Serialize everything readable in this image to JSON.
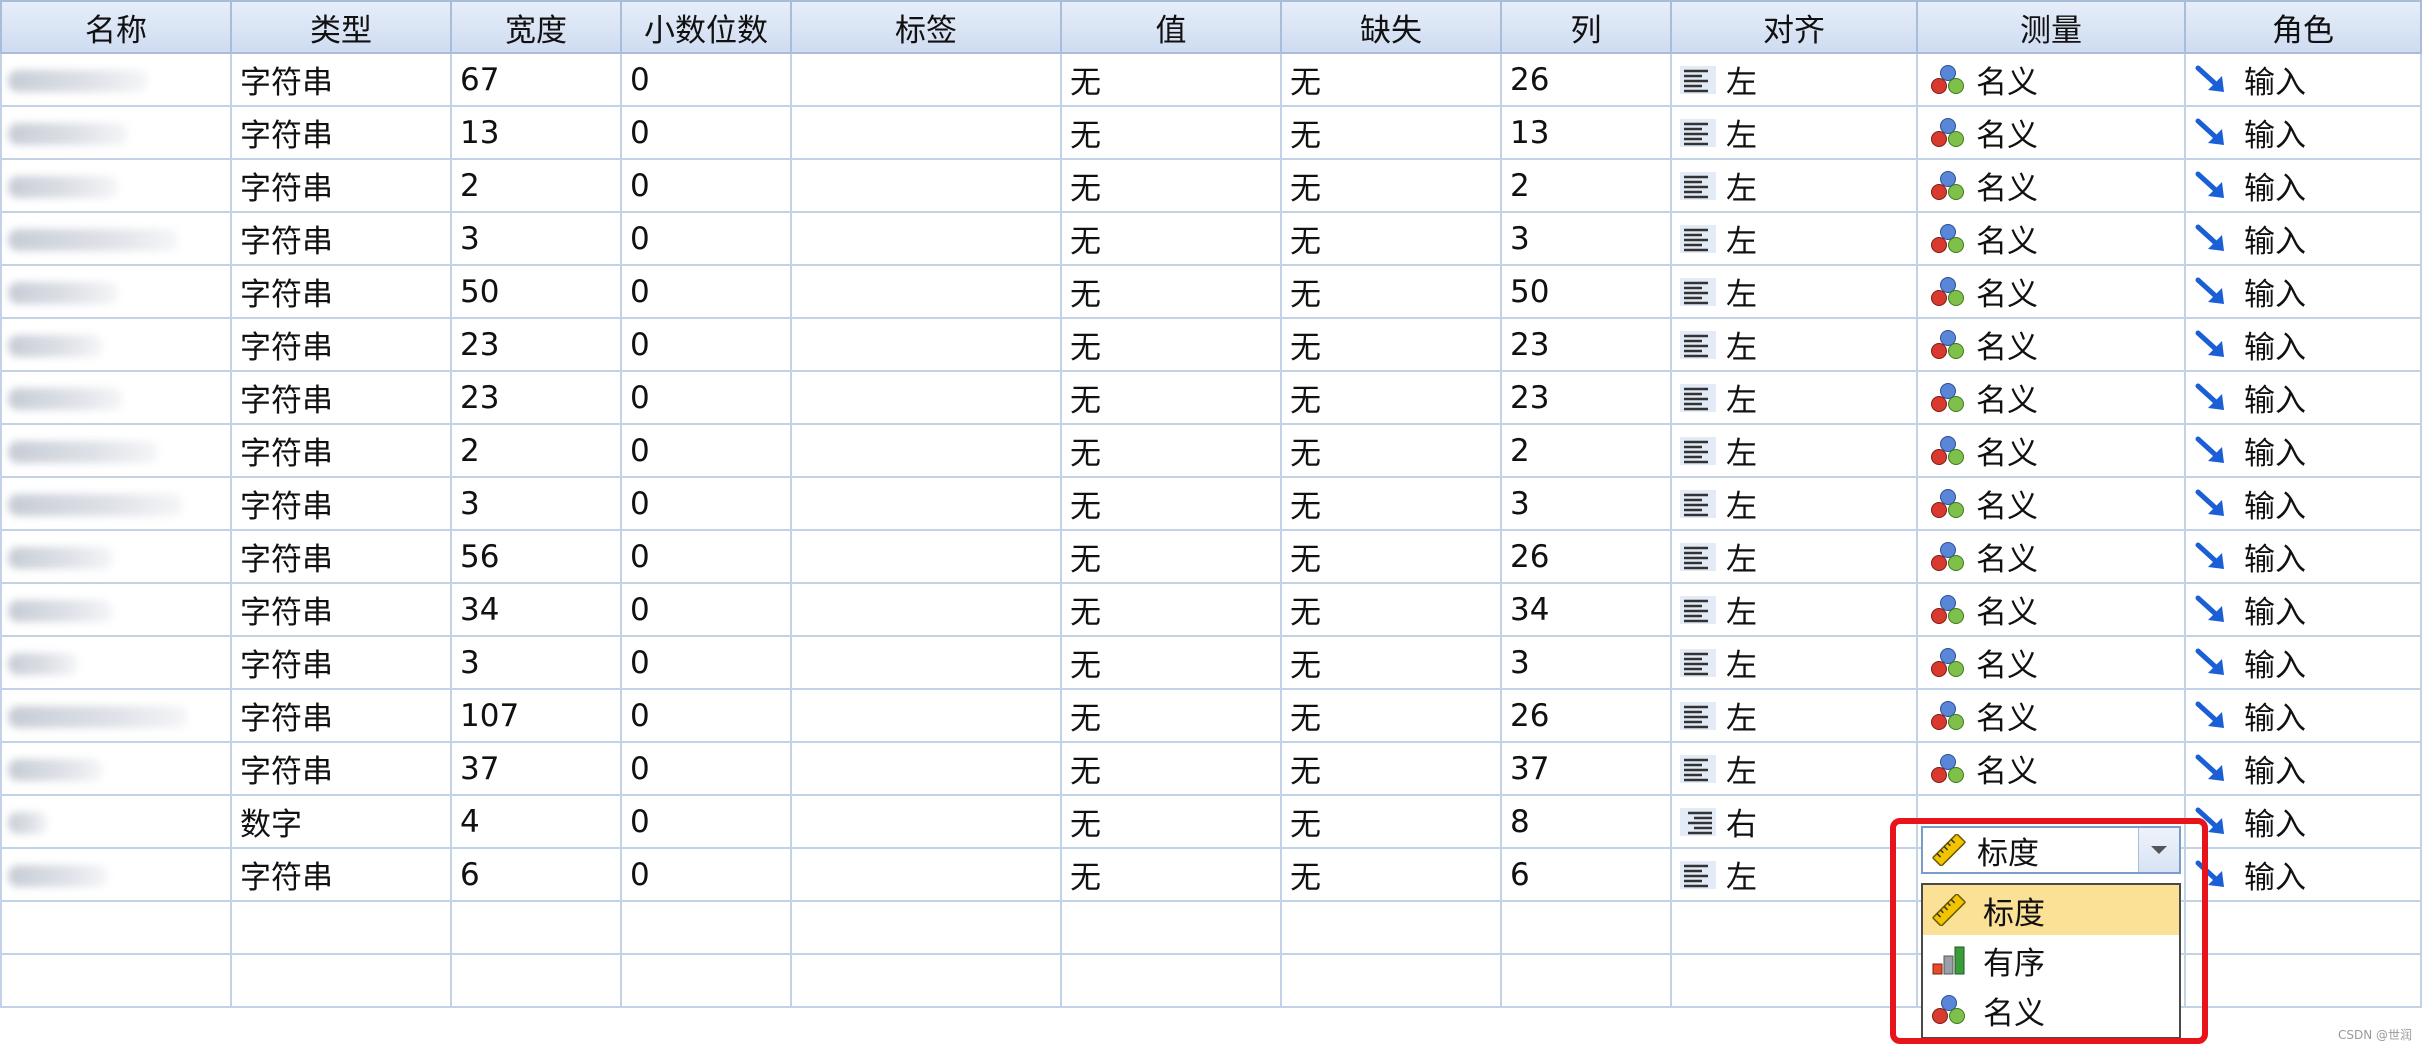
{
  "columns": [
    "名称",
    "类型",
    "宽度",
    "小数位数",
    "标签",
    "值",
    "缺失",
    "列",
    "对齐",
    "测量",
    "角色"
  ],
  "rows": [
    {
      "name": "",
      "type": "字符串",
      "width": "67",
      "decimals": "0",
      "label": "",
      "values": "无",
      "missing": "无",
      "columns": "26",
      "align": "左",
      "measure": "名义",
      "role": "输入"
    },
    {
      "name": "",
      "type": "字符串",
      "width": "13",
      "decimals": "0",
      "label": "",
      "values": "无",
      "missing": "无",
      "columns": "13",
      "align": "左",
      "measure": "名义",
      "role": "输入"
    },
    {
      "name": "",
      "type": "字符串",
      "width": "2",
      "decimals": "0",
      "label": "",
      "values": "无",
      "missing": "无",
      "columns": "2",
      "align": "左",
      "measure": "名义",
      "role": "输入"
    },
    {
      "name": "",
      "type": "字符串",
      "width": "3",
      "decimals": "0",
      "label": "",
      "values": "无",
      "missing": "无",
      "columns": "3",
      "align": "左",
      "measure": "名义",
      "role": "输入"
    },
    {
      "name": "",
      "type": "字符串",
      "width": "50",
      "decimals": "0",
      "label": "",
      "values": "无",
      "missing": "无",
      "columns": "50",
      "align": "左",
      "measure": "名义",
      "role": "输入"
    },
    {
      "name": "",
      "type": "字符串",
      "width": "23",
      "decimals": "0",
      "label": "",
      "values": "无",
      "missing": "无",
      "columns": "23",
      "align": "左",
      "measure": "名义",
      "role": "输入"
    },
    {
      "name": "",
      "type": "字符串",
      "width": "23",
      "decimals": "0",
      "label": "",
      "values": "无",
      "missing": "无",
      "columns": "23",
      "align": "左",
      "measure": "名义",
      "role": "输入"
    },
    {
      "name": "",
      "type": "字符串",
      "width": "2",
      "decimals": "0",
      "label": "",
      "values": "无",
      "missing": "无",
      "columns": "2",
      "align": "左",
      "measure": "名义",
      "role": "输入"
    },
    {
      "name": "",
      "type": "字符串",
      "width": "3",
      "decimals": "0",
      "label": "",
      "values": "无",
      "missing": "无",
      "columns": "3",
      "align": "左",
      "measure": "名义",
      "role": "输入"
    },
    {
      "name": "",
      "type": "字符串",
      "width": "56",
      "decimals": "0",
      "label": "",
      "values": "无",
      "missing": "无",
      "columns": "26",
      "align": "左",
      "measure": "名义",
      "role": "输入"
    },
    {
      "name": "",
      "type": "字符串",
      "width": "34",
      "decimals": "0",
      "label": "",
      "values": "无",
      "missing": "无",
      "columns": "34",
      "align": "左",
      "measure": "名义",
      "role": "输入"
    },
    {
      "name": "",
      "type": "字符串",
      "width": "3",
      "decimals": "0",
      "label": "",
      "values": "无",
      "missing": "无",
      "columns": "3",
      "align": "左",
      "measure": "名义",
      "role": "输入"
    },
    {
      "name": "",
      "type": "字符串",
      "width": "107",
      "decimals": "0",
      "label": "",
      "values": "无",
      "missing": "无",
      "columns": "26",
      "align": "左",
      "measure": "名义",
      "role": "输入"
    },
    {
      "name": "",
      "type": "字符串",
      "width": "37",
      "decimals": "0",
      "label": "",
      "values": "无",
      "missing": "无",
      "columns": "37",
      "align": "左",
      "measure": "名义",
      "role": "输入"
    },
    {
      "name": "",
      "type": "数字",
      "width": "4",
      "decimals": "0",
      "label": "",
      "values": "无",
      "missing": "无",
      "columns": "8",
      "align": "右",
      "measure": "",
      "role": "输入"
    },
    {
      "name": "",
      "type": "字符串",
      "width": "6",
      "decimals": "0",
      "label": "",
      "values": "无",
      "missing": "无",
      "columns": "6",
      "align": "左",
      "measure": "",
      "role": "输入"
    }
  ],
  "empty_rows": 2,
  "measure_dropdown": {
    "current": "标度",
    "options": [
      {
        "label": "标度",
        "icon": "ruler-icon",
        "selected": true
      },
      {
        "label": "有序",
        "icon": "ordinal-bars-icon",
        "selected": false
      },
      {
        "label": "名义",
        "icon": "nominal-circles-icon",
        "selected": false
      }
    ]
  },
  "watermark": "CSDN @世润",
  "colors": {
    "header_bg": "#d8e3f4",
    "grid_line": "#c3d3e6",
    "selection": "#fbe195",
    "callout": "#e8141c",
    "role_arrow": "#1a5fd6"
  }
}
